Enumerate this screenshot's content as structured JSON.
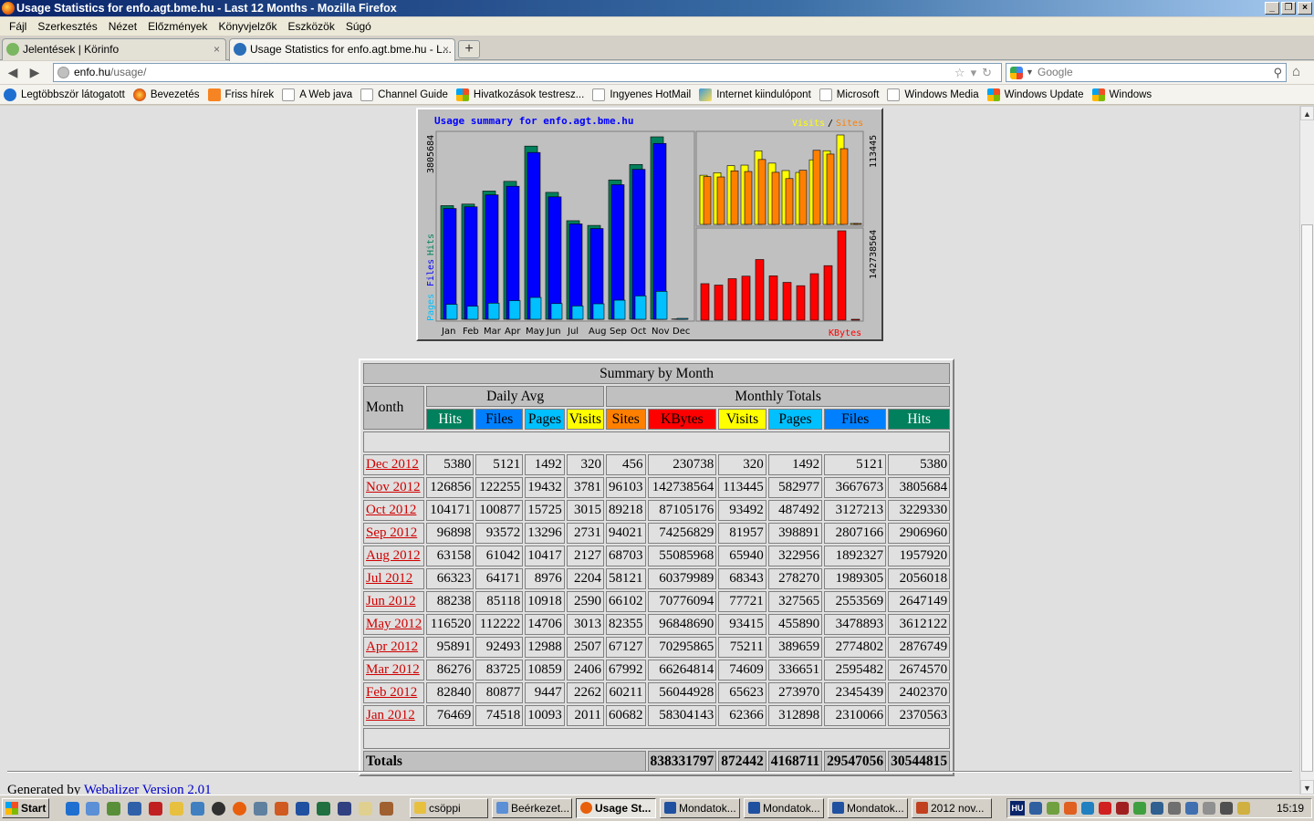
{
  "window": {
    "title": "Usage Statistics for enfo.agt.bme.hu - Last 12 Months - Mozilla Firefox"
  },
  "menu": [
    "Fájl",
    "Szerkesztés",
    "Nézet",
    "Előzmények",
    "Könyvjelzők",
    "Eszközök",
    "Súgó"
  ],
  "tabs": [
    {
      "label": "Jelentések | Körinfo"
    },
    {
      "label": "Usage Statistics for enfo.agt.bme.hu - L..."
    }
  ],
  "url": {
    "host": "enfo.hu",
    "path": "/usage/"
  },
  "search": {
    "placeholder": "Google"
  },
  "bookmarks": [
    "Legtöbbször látogatott",
    "Bevezetés",
    "Friss hírek",
    "A Web java",
    "Channel Guide",
    "Hivatkozások testresz...",
    "Ingyenes HotMail",
    "Internet kiindulópont",
    "Microsoft",
    "Windows Media",
    "Windows Update",
    "Windows"
  ],
  "graph": {
    "title": "Usage summary for enfo.agt.bme.hu",
    "legend_visits": "Visits",
    "legend_slash": "/",
    "legend_sites": "Sites",
    "left_axis_max": "3805684",
    "left_label_pages": "Pages",
    "left_label_files": "Files",
    "left_label_hits": "Hits",
    "right_top_max": "113445",
    "right_bottom_max": "142738564",
    "kbytes_label": "KBytes",
    "months": [
      "Jan",
      "Feb",
      "Mar",
      "Apr",
      "May",
      "Jun",
      "Jul",
      "Aug",
      "Sep",
      "Oct",
      "Nov",
      "Dec"
    ]
  },
  "chart_data": {
    "type": "bar",
    "categories": [
      "Jan",
      "Feb",
      "Mar",
      "Apr",
      "May",
      "Jun",
      "Jul",
      "Aug",
      "Sep",
      "Oct",
      "Nov",
      "Dec"
    ],
    "series": [
      {
        "name": "Hits",
        "values": [
          2370563,
          2402370,
          2674570,
          2876749,
          3612122,
          2647149,
          2056018,
          1957920,
          2906960,
          3229330,
          3805684,
          5380
        ]
      },
      {
        "name": "Files",
        "values": [
          2310066,
          2345439,
          2595482,
          2774802,
          3478893,
          2553569,
          1989305,
          1892327,
          2807166,
          3127213,
          3667673,
          5121
        ]
      },
      {
        "name": "Pages",
        "values": [
          312898,
          273970,
          336651,
          389659,
          455890,
          327565,
          278270,
          322956,
          398891,
          487492,
          582977,
          1492
        ]
      },
      {
        "name": "Visits",
        "values": [
          62366,
          65623,
          74609,
          75211,
          93415,
          77721,
          68343,
          65940,
          81957,
          93492,
          113445,
          320
        ]
      },
      {
        "name": "Sites",
        "values": [
          60682,
          60211,
          67992,
          67127,
          82355,
          66102,
          58121,
          68703,
          94021,
          89218,
          96103,
          456
        ]
      },
      {
        "name": "KBytes",
        "values": [
          58304143,
          56044928,
          66264814,
          70295865,
          96848690,
          70776094,
          60379989,
          55085968,
          74256829,
          87105176,
          142738564,
          230738
        ]
      }
    ],
    "title": "Usage summary for enfo.agt.bme.hu"
  },
  "table": {
    "title": "Summary by Month",
    "month_header": "Month",
    "daily_avg_header": "Daily Avg",
    "monthly_totals_header": "Monthly Totals",
    "col_headers": [
      "Hits",
      "Files",
      "Pages",
      "Visits",
      "Sites",
      "KBytes",
      "Visits",
      "Pages",
      "Files",
      "Hits"
    ],
    "rows": [
      [
        "Dec 2012",
        "5380",
        "5121",
        "1492",
        "320",
        "456",
        "230738",
        "320",
        "1492",
        "5121",
        "5380"
      ],
      [
        "Nov 2012",
        "126856",
        "122255",
        "19432",
        "3781",
        "96103",
        "142738564",
        "113445",
        "582977",
        "3667673",
        "3805684"
      ],
      [
        "Oct 2012",
        "104171",
        "100877",
        "15725",
        "3015",
        "89218",
        "87105176",
        "93492",
        "487492",
        "3127213",
        "3229330"
      ],
      [
        "Sep 2012",
        "96898",
        "93572",
        "13296",
        "2731",
        "94021",
        "74256829",
        "81957",
        "398891",
        "2807166",
        "2906960"
      ],
      [
        "Aug 2012",
        "63158",
        "61042",
        "10417",
        "2127",
        "68703",
        "55085968",
        "65940",
        "322956",
        "1892327",
        "1957920"
      ],
      [
        "Jul 2012",
        "66323",
        "64171",
        "8976",
        "2204",
        "58121",
        "60379989",
        "68343",
        "278270",
        "1989305",
        "2056018"
      ],
      [
        "Jun 2012",
        "88238",
        "85118",
        "10918",
        "2590",
        "66102",
        "70776094",
        "77721",
        "327565",
        "2553569",
        "2647149"
      ],
      [
        "May 2012",
        "116520",
        "112222",
        "14706",
        "3013",
        "82355",
        "96848690",
        "93415",
        "455890",
        "3478893",
        "3612122"
      ],
      [
        "Apr 2012",
        "95891",
        "92493",
        "12988",
        "2507",
        "67127",
        "70295865",
        "75211",
        "389659",
        "2774802",
        "2876749"
      ],
      [
        "Mar 2012",
        "86276",
        "83725",
        "10859",
        "2406",
        "67992",
        "66264814",
        "74609",
        "336651",
        "2595482",
        "2674570"
      ],
      [
        "Feb 2012",
        "82840",
        "80877",
        "9447",
        "2262",
        "60211",
        "56044928",
        "65623",
        "273970",
        "2345439",
        "2402370"
      ],
      [
        "Jan 2012",
        "76469",
        "74518",
        "10093",
        "2011",
        "60682",
        "58304143",
        "62366",
        "312898",
        "2310066",
        "2370563"
      ]
    ],
    "totals_label": "Totals",
    "totals": [
      "838331797",
      "872442",
      "4168711",
      "29547056",
      "30544815"
    ]
  },
  "footer": {
    "prefix": "Generated by ",
    "link": "Webalizer Version 2.01"
  },
  "taskbar": {
    "start": "Start",
    "tasks": [
      "csöppi",
      "Beérkezet...",
      "Usage St...",
      "Mondatok...",
      "Mondatok...",
      "Mondatok...",
      "2012 nov..."
    ],
    "lang": "HU",
    "clock": "15:19"
  },
  "colors": {
    "hits": "#00805c",
    "files": "#0080ff",
    "pages": "#00c0ff",
    "visits": "#ffff00",
    "sites": "#ff8000",
    "kbytes": "#ff0000"
  }
}
